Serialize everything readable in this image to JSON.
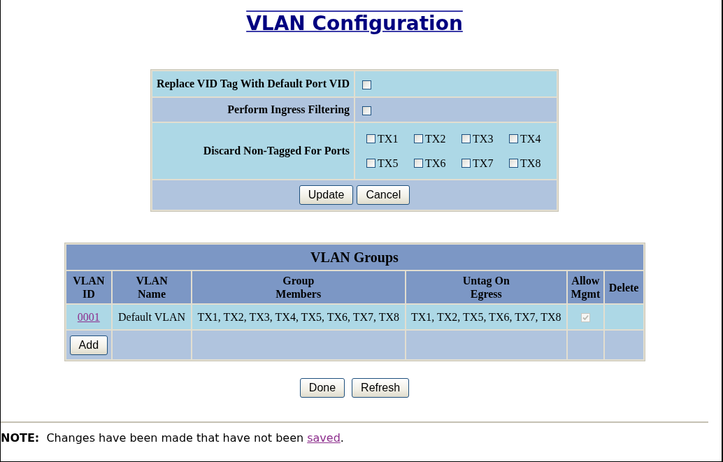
{
  "title": "VLAN Configuration",
  "settings": {
    "rows": [
      {
        "kind": "checkbox",
        "label": "Replace VID Tag With Default Port VID",
        "checked": false
      },
      {
        "kind": "checkbox",
        "label": "Perform Ingress Filtering",
        "checked": false
      },
      {
        "kind": "ports",
        "label": "Discard Non-Tagged For Ports",
        "ports": [
          {
            "label": "TX1",
            "checked": false
          },
          {
            "label": "TX2",
            "checked": false
          },
          {
            "label": "TX3",
            "checked": false
          },
          {
            "label": "TX4",
            "checked": false
          },
          {
            "label": "TX5",
            "checked": false
          },
          {
            "label": "TX6",
            "checked": false
          },
          {
            "label": "TX7",
            "checked": false
          },
          {
            "label": "TX8",
            "checked": false
          }
        ]
      }
    ],
    "buttons": [
      "Update",
      "Cancel"
    ]
  },
  "vlan_groups": {
    "title": "VLAN Groups",
    "columns": [
      {
        "lines": [
          "VLAN",
          "ID"
        ]
      },
      {
        "lines": [
          "VLAN",
          "Name"
        ]
      },
      {
        "lines": [
          "Group",
          "Members"
        ]
      },
      {
        "lines": [
          "Untag On",
          "Egress"
        ]
      },
      {
        "lines": [
          "Allow",
          "Mgmt"
        ]
      },
      {
        "lines": [
          "Delete"
        ]
      }
    ],
    "rows": [
      {
        "vlan_id": "0001",
        "name": "Default VLAN",
        "group_members": "TX1, TX2, TX3, TX4, TX5, TX6, TX7, TX8",
        "untag_on_egress": "TX1, TX2, TX5, TX6, TX7, TX8",
        "allow_mgmt": {
          "checked": true,
          "disabled": true
        }
      }
    ],
    "add_button": "Add"
  },
  "buttons": [
    "Done",
    "Refresh"
  ],
  "note": {
    "text": "**NOTE:**  Changes have been made that have not been",
    "link": "saved",
    "tail": "."
  }
}
